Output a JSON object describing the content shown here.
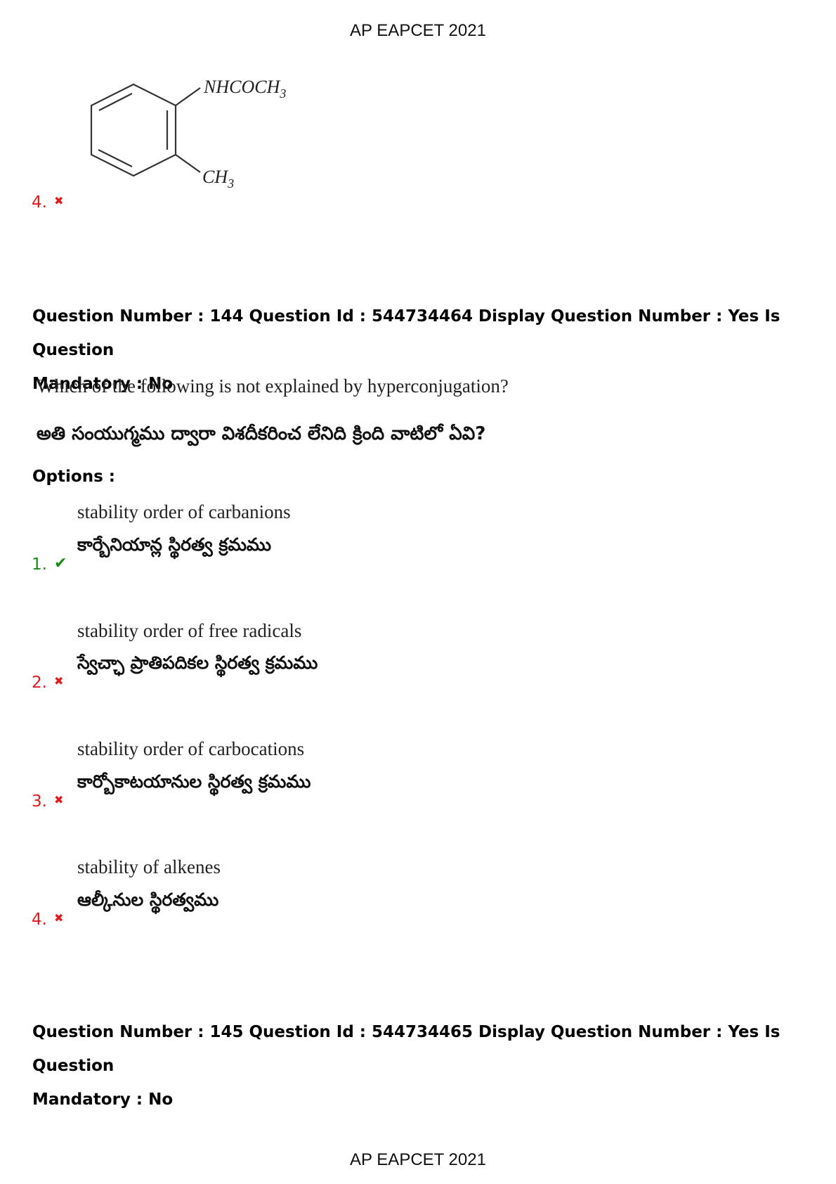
{
  "header": {
    "title": "AP EAPCET 2021"
  },
  "prev_option": {
    "number": "4.",
    "structure": {
      "top_group_text": "NHCOCH",
      "top_group_subscript": "3",
      "bottom_group_text": "CH",
      "bottom_group_subscript": "3"
    },
    "mark_icon": "cross-icon"
  },
  "question": {
    "info_line1": "Question Number : 144 Question Id : 544734464 Display Question Number : Yes Is Question",
    "info_line2": "Mandatory : No",
    "text_en": "Which of the following is not explained by hyperconjugation?",
    "text_te": "అతి సంయుగ్మము ద్వారా విశదీకరించ లేనిది క్రింది వాటిలో ఏవి?",
    "options_label": "Options :",
    "options": [
      {
        "number": "1.",
        "en": "stability order of carbanions",
        "te": "కార్బేనియాన్ల స్థిరత్వ క్రమము",
        "correct": true
      },
      {
        "number": "2.",
        "en": "stability order of free radicals",
        "te": "స్వేచ్ఛా ప్రాతిపదికల స్థిరత్వ క్రమము",
        "correct": false
      },
      {
        "number": "3.",
        "en": "stability order of carbocations",
        "te": "కార్బోకాటయానుల స్థిరత్వ క్రమము",
        "correct": false
      },
      {
        "number": "4.",
        "en": "stability of alkenes",
        "te": "ఆల్కీనుల స్థిరత్వము",
        "correct": false
      }
    ]
  },
  "next_question": {
    "info_line1": "Question Number : 145 Question Id : 544734465 Display Question Number : Yes Is Question",
    "info_line2": "Mandatory : No"
  },
  "footer": {
    "title": "AP EAPCET 2021"
  },
  "colors": {
    "correct": "#1a8a1a",
    "wrong": "#e01b1b"
  }
}
